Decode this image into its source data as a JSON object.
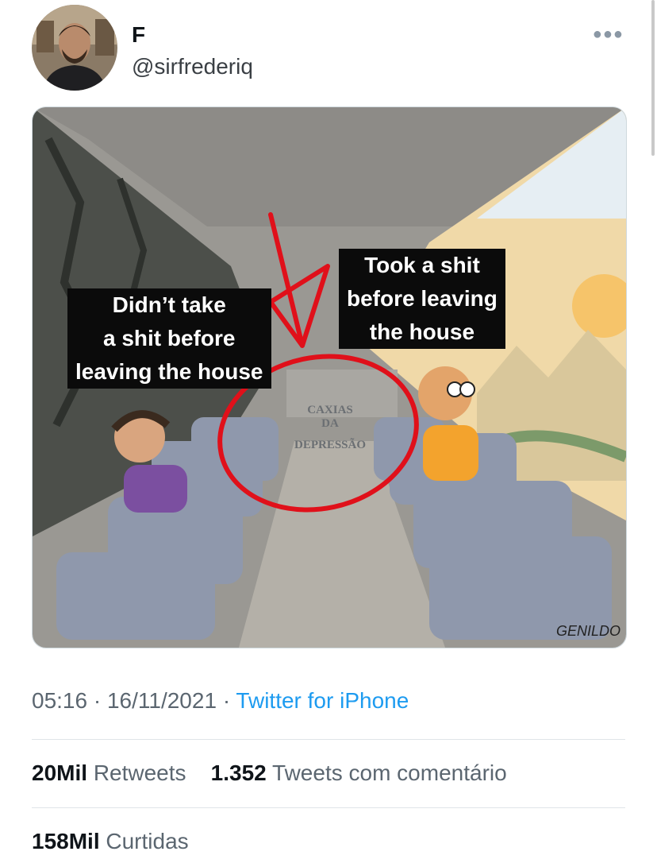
{
  "tweet": {
    "author_name": "F",
    "author_handle": "@sirfrederiq",
    "more_icon": "more-horizontal-icon"
  },
  "meme": {
    "caption_left": [
      "Didn’t take",
      "a shit before",
      "leaving the house"
    ],
    "caption_right": [
      "Took a shit",
      "before leaving",
      "the house"
    ],
    "watermark": [
      "CAXIAS",
      "DA",
      "DEPRESSÃO"
    ],
    "signature": "GENILDO"
  },
  "meta": {
    "time": "05:16",
    "date": "16/11/2021",
    "source": "Twitter for iPhone"
  },
  "stats": {
    "retweets_count": "20Mil",
    "retweets_label": "Retweets",
    "quotes_count": "1.352",
    "quotes_label": "Tweets com comentário",
    "likes_count": "158Mil",
    "likes_label": "Curtidas"
  }
}
